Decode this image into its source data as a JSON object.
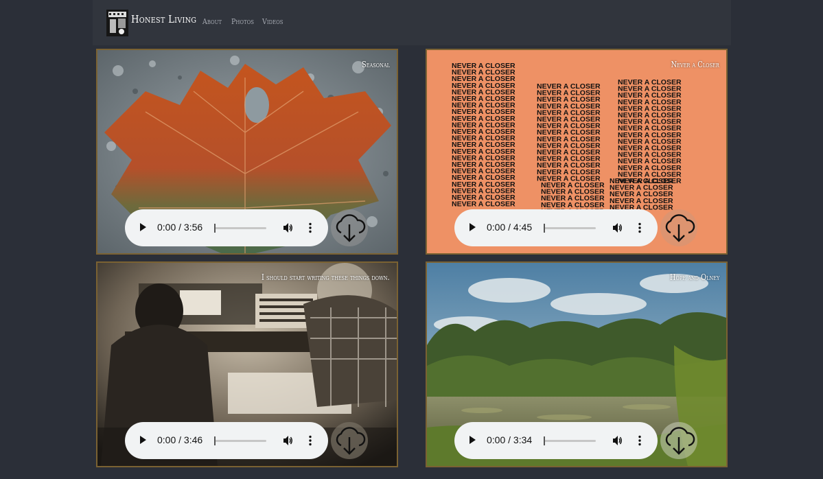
{
  "brand": {
    "name": "Honest Living",
    "logo_icon": "band-logo-icon"
  },
  "nav": {
    "items": [
      {
        "label": "About"
      },
      {
        "label": "Photos"
      },
      {
        "label": "Videos"
      }
    ]
  },
  "colors": {
    "page_bg": "#2b2f38",
    "navbar_bg": "#31353d",
    "card_border": "#7b6232",
    "player_bg": "#f1f3f4"
  },
  "tracks": [
    {
      "title": "Seasonal",
      "time": "0:00 / 3:56",
      "cover": "autumn-leaf"
    },
    {
      "title": "Never a Closer",
      "time": "0:00 / 4:45",
      "cover": "never-a-closer-text"
    },
    {
      "title": "I should start writing these things down.",
      "time": "0:00 / 3:46",
      "cover": "studio-sepia"
    },
    {
      "title": "Hope and Olney",
      "time": "0:00 / 3:34",
      "cover": "pond-forest"
    }
  ],
  "cover_text": {
    "repeated_phrase": "NEVER A CLOSER"
  },
  "icons": {
    "play": "play-icon",
    "volume": "volume-icon",
    "more": "more-options-icon",
    "download": "cloud-download-icon"
  }
}
